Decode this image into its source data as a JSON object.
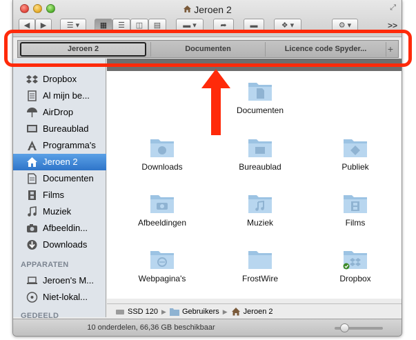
{
  "window": {
    "title": "Jeroen 2"
  },
  "tabs": [
    {
      "label": "Jeroen 2",
      "active": true
    },
    {
      "label": "Documenten",
      "active": false
    },
    {
      "label": "Licence code Spyder...",
      "active": false
    }
  ],
  "tab_add_label": "+",
  "toolbar": {
    "icons": [
      "back-icon",
      "forward-icon",
      "arrange-icon",
      "icon-view-icon",
      "list-view-icon",
      "column-view-icon",
      "coverflow-view-icon",
      "action-icon",
      "share-icon",
      "tag-icon",
      "dropbox-icon",
      "settings-icon"
    ],
    "more_label": ">>"
  },
  "sidebar": {
    "favorites": [
      {
        "label": "Dropbox",
        "icon": "dropbox-icon"
      },
      {
        "label": "Al mijn be...",
        "icon": "all-files-icon"
      },
      {
        "label": "AirDrop",
        "icon": "airdrop-icon"
      },
      {
        "label": "Bureaublad",
        "icon": "desktop-icon"
      },
      {
        "label": "Programma's",
        "icon": "applications-icon"
      },
      {
        "label": "Jeroen 2",
        "icon": "home-icon",
        "selected": true
      },
      {
        "label": "Documenten",
        "icon": "documents-icon"
      },
      {
        "label": "Films",
        "icon": "movies-icon"
      },
      {
        "label": "Muziek",
        "icon": "music-icon"
      },
      {
        "label": "Afbeeldin...",
        "icon": "pictures-icon"
      },
      {
        "label": "Downloads",
        "icon": "downloads-icon"
      }
    ],
    "devices_header": "APPARATEN",
    "devices": [
      {
        "label": "Jeroen's M...",
        "icon": "laptop-icon"
      },
      {
        "label": "Niet-lokal...",
        "icon": "disc-icon"
      }
    ],
    "shared_header": "GEDEELD"
  },
  "files": [
    {
      "label": "Documenten",
      "icon": "documents-folder-icon"
    },
    {
      "label": "Downloads",
      "icon": "downloads-folder-icon"
    },
    {
      "label": "Bureaublad",
      "icon": "desktop-folder-icon"
    },
    {
      "label": "Publiek",
      "icon": "public-folder-icon"
    },
    {
      "label": "Afbeeldingen",
      "icon": "pictures-folder-icon"
    },
    {
      "label": "Muziek",
      "icon": "music-folder-icon"
    },
    {
      "label": "Films",
      "icon": "movies-folder-icon"
    },
    {
      "label": "Webpagina's",
      "icon": "sites-folder-icon"
    },
    {
      "label": "FrostWire",
      "icon": "folder-icon"
    },
    {
      "label": "Dropbox",
      "icon": "dropbox-folder-icon"
    }
  ],
  "pathbar": [
    "SSD 120",
    "Gebruikers",
    "Jeroen 2"
  ],
  "status": "10 onderdelen, 66,36 GB beschikbaar",
  "colors": {
    "highlight": "#ff2a0a",
    "selection": "#3a82d6",
    "folder": "#9cc3e3"
  }
}
